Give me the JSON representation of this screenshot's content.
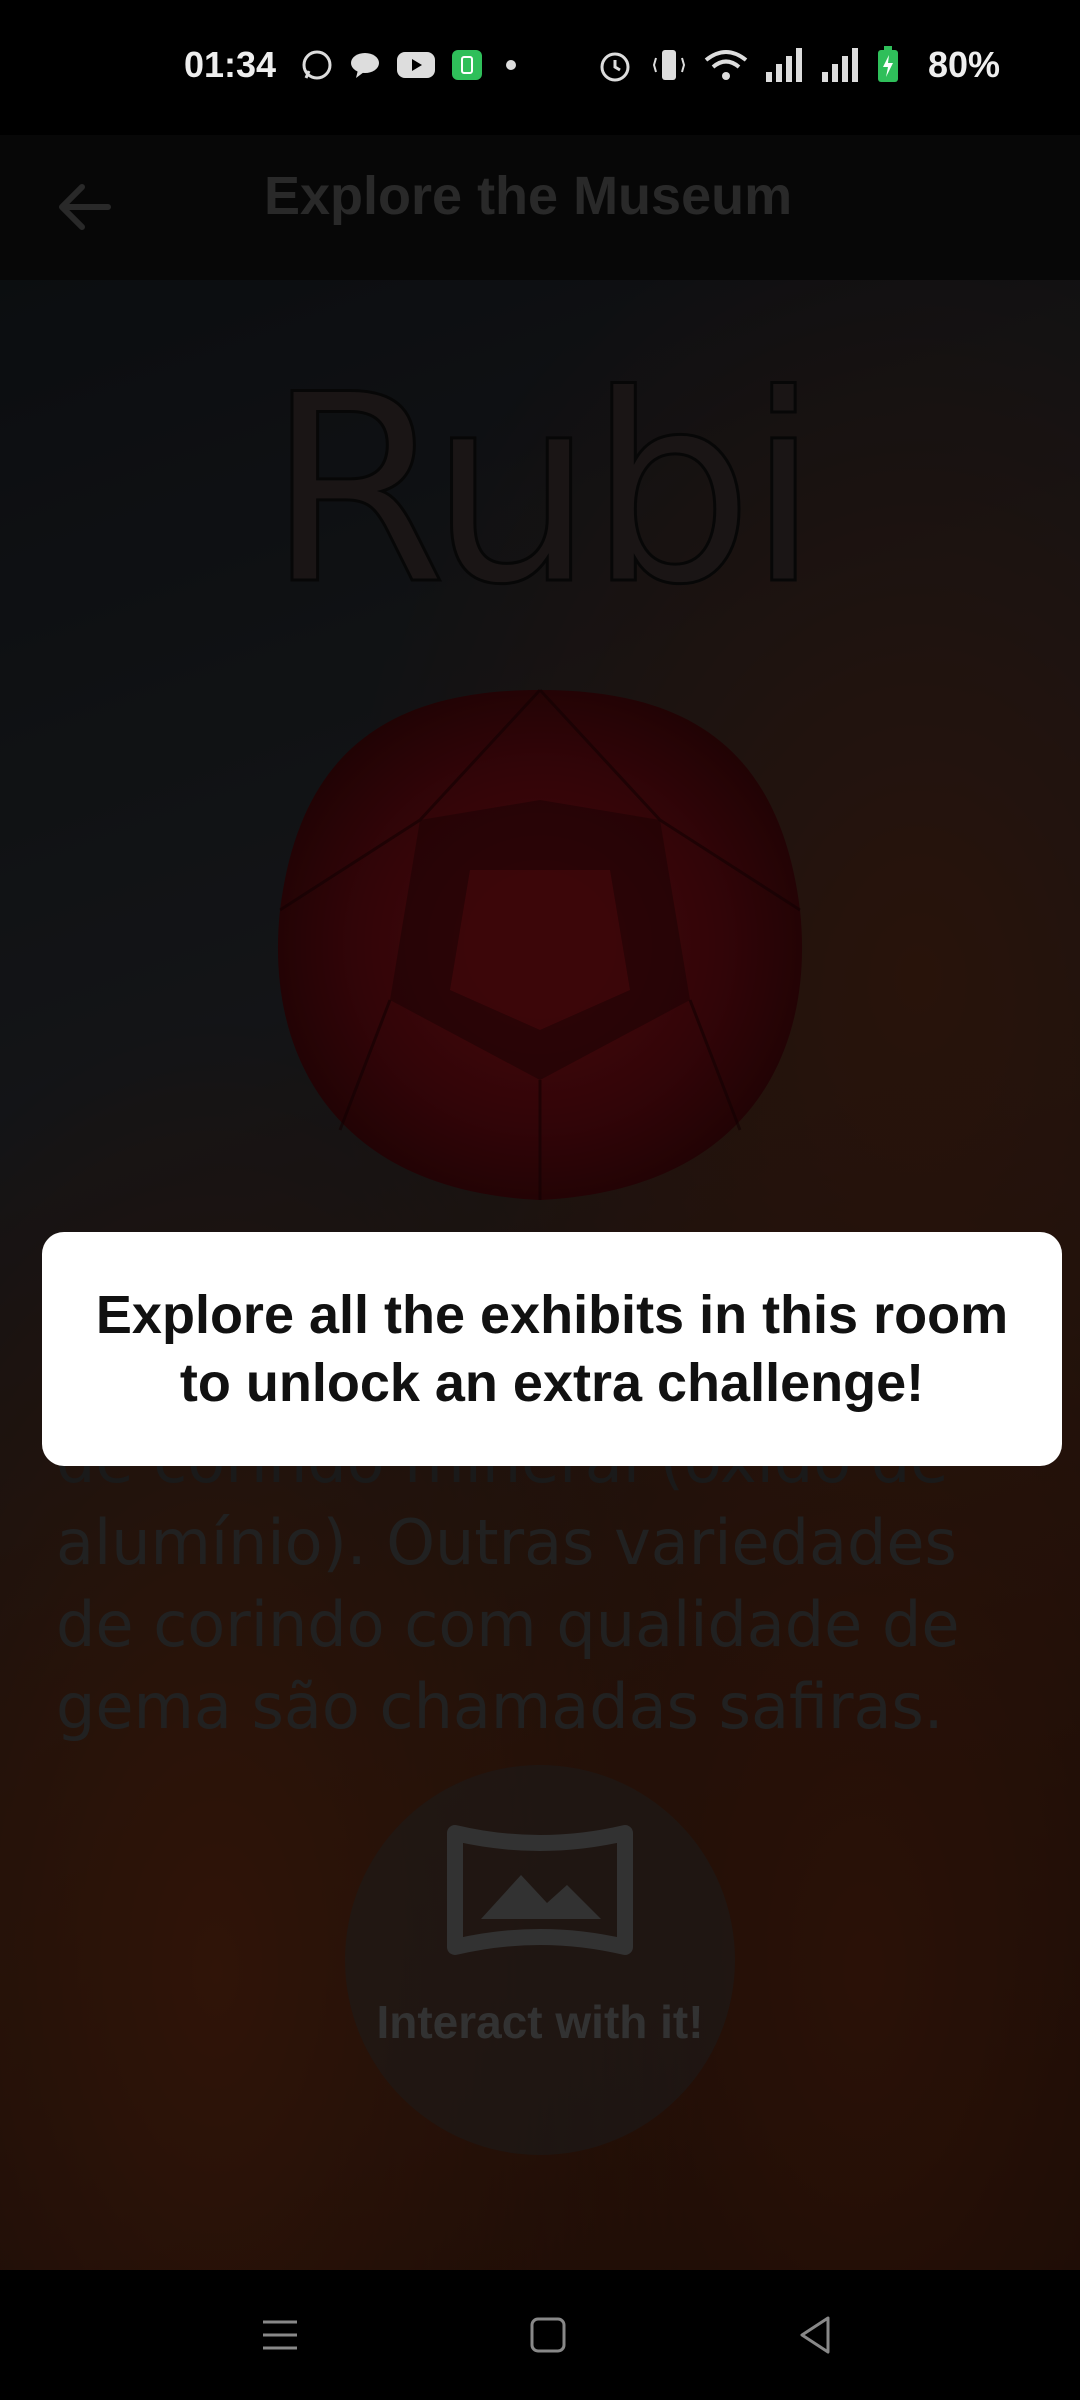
{
  "status_bar": {
    "time": "01:34",
    "battery": "80%",
    "icons": [
      "whatsapp-icon",
      "chat-icon",
      "youtube-icon",
      "battery-saver-icon",
      "alarm-icon",
      "vibrate-icon",
      "wifi-icon",
      "signal-icon",
      "signal-icon",
      "battery-icon"
    ]
  },
  "app_bar": {
    "title": "Explore the Museum",
    "back_icon": "back-arrow-icon"
  },
  "exhibit": {
    "title": "Rubi",
    "description_partial": "de corindo mineral (óxido de",
    "description": "alumínio). Outras variedades de corindo com qualidade de gema são chamadas safiras."
  },
  "interact": {
    "label": "Interact with it!",
    "icon": "panorama-icon"
  },
  "dialog": {
    "message": "Explore all the exhibits in this room to unlock an extra challenge!"
  },
  "nav": {
    "menu_icon": "menu-icon",
    "home_icon": "home-icon",
    "back_icon": "back-triangle-icon"
  },
  "colors": {
    "dialog_bg": "#ffffff",
    "overlay": "#000000",
    "gem": "#7a0f14"
  }
}
